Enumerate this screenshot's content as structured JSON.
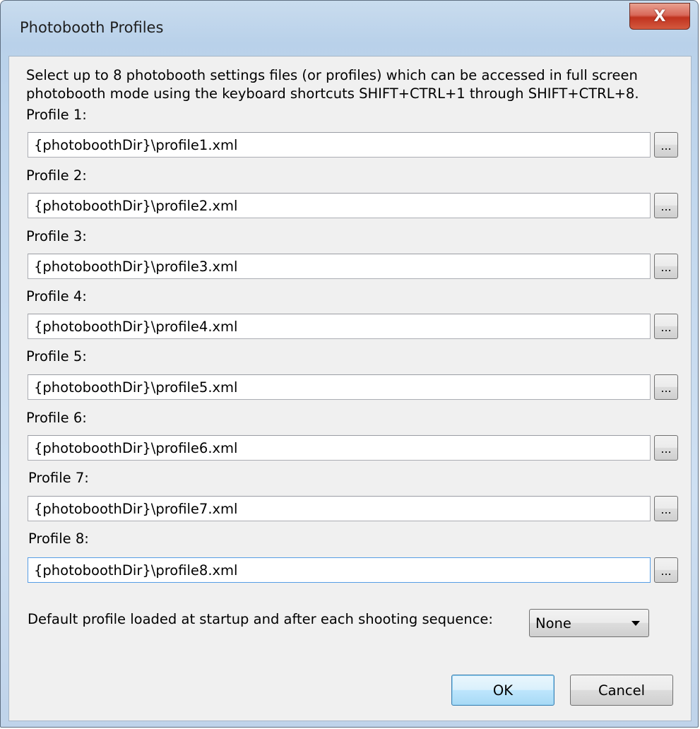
{
  "window": {
    "title": "Photobooth Profiles",
    "close_glyph": "X"
  },
  "intro_text": "Select up to 8 photobooth settings files (or profiles) which can be accessed in full screen\nphotobooth mode using the keyboard shortcuts SHIFT+CTRL+1 through SHIFT+CTRL+8.",
  "profiles": [
    {
      "label": "Profile 1:",
      "value": "{photoboothDir}\\profile1.xml",
      "browse": "..."
    },
    {
      "label": "Profile 2:",
      "value": "{photoboothDir}\\profile2.xml",
      "browse": "..."
    },
    {
      "label": "Profile 3:",
      "value": "{photoboothDir}\\profile3.xml",
      "browse": "..."
    },
    {
      "label": "Profile 4:",
      "value": "{photoboothDir}\\profile4.xml",
      "browse": "..."
    },
    {
      "label": "Profile 5:",
      "value": "{photoboothDir}\\profile5.xml",
      "browse": "..."
    },
    {
      "label": "Profile 6:",
      "value": "{photoboothDir}\\profile6.xml",
      "browse": "..."
    },
    {
      "label": "Profile 7:",
      "value": "{photoboothDir}\\profile7.xml",
      "browse": "..."
    },
    {
      "label": "Profile 8:",
      "value": "{photoboothDir}\\profile8.xml",
      "browse": "..."
    }
  ],
  "default_profile": {
    "label": "Default profile loaded at startup and after each shooting sequence:",
    "selected": "None"
  },
  "buttons": {
    "ok": "OK",
    "cancel": "Cancel"
  }
}
